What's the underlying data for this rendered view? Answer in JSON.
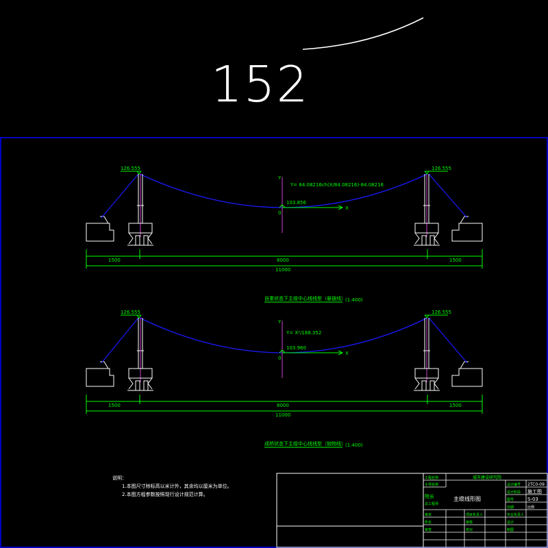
{
  "page_number": "152",
  "colors": {
    "background": "#000000",
    "frame": "#0000ff",
    "cable": "#1a1aff",
    "annotation": "#00ff00",
    "structure": "#ffffff",
    "axis_marker": "#cc44cc"
  },
  "elevations": {
    "top_tower_left": "126.555",
    "top_tower_right": "126.555",
    "top_sag": "103.856",
    "bottom_tower_left": "126.555",
    "bottom_tower_right": "126.555",
    "bottom_sag": "103.960"
  },
  "axes": {
    "x": "X",
    "y": "Y",
    "o": "0"
  },
  "equations": {
    "top": "Y= 84.08216ch(X/84.08216)-84.08216",
    "bottom": "Y= X²/188.352"
  },
  "dimensions": {
    "side_left": "1500",
    "main": "8000",
    "side_right": "1500",
    "total": "11000"
  },
  "captions": {
    "top_title": "自重状态下主缆中心线线型（悬链线）",
    "top_scale": "(1:400)",
    "bottom_title": "成桥状态下主缆中心线线型（抛物线）",
    "bottom_scale": "(1:400)"
  },
  "notes": {
    "heading": "说明：",
    "items": [
      "1.本图尺寸除标高以米计外，其余均以厘米为单位。",
      "2.本图方程参数按照现行设计规范计算。"
    ]
  },
  "title_block": {
    "institute": "城市建设研究院",
    "drawing_title": "主缆线形图",
    "labels": {
      "project_name": "工程名称",
      "sub_project": "子项名称",
      "drawing_no": "设计编号",
      "design_stage": "设计阶段",
      "sheet_no": "图号",
      "date": "日期",
      "project_lead": "项目负责人",
      "discipline_lead": "专业负责人",
      "approver": "审定",
      "checker": "审核",
      "reviewer": "审查",
      "designer": "设计",
      "drafter": "制图",
      "director": "院长",
      "chief_engineer": "总工程师",
      "proofreader": "校对",
      "chief": "所长"
    },
    "values": {
      "drawing_no": "2TC0-09",
      "design_stage": "施工图",
      "sheet_no": "S-03",
      "scale_tag": "比例"
    }
  }
}
